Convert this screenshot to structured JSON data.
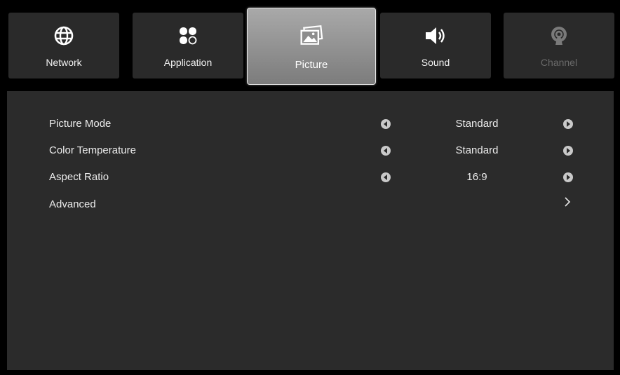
{
  "tabs": [
    {
      "label": "Network",
      "icon": "globe-icon",
      "state": "normal"
    },
    {
      "label": "Application",
      "icon": "apps-icon",
      "state": "normal"
    },
    {
      "label": "Picture",
      "icon": "picture-icon",
      "state": "active"
    },
    {
      "label": "Sound",
      "icon": "speaker-icon",
      "state": "normal"
    },
    {
      "label": "Channel",
      "icon": "antenna-icon",
      "state": "disabled"
    }
  ],
  "settings": [
    {
      "label": "Picture Mode",
      "value": "Standard"
    },
    {
      "label": "Color Temperature",
      "value": "Standard"
    },
    {
      "label": "Aspect Ratio",
      "value": "16:9"
    },
    {
      "label": "Advanced",
      "value": ""
    }
  ],
  "colors": {
    "background": "#000000",
    "panel": "#2b2b2b",
    "tab": "#2a2a2a",
    "tab_active": "#9a9a9a",
    "text": "#ececec",
    "disabled_text": "#6a6a6a"
  }
}
